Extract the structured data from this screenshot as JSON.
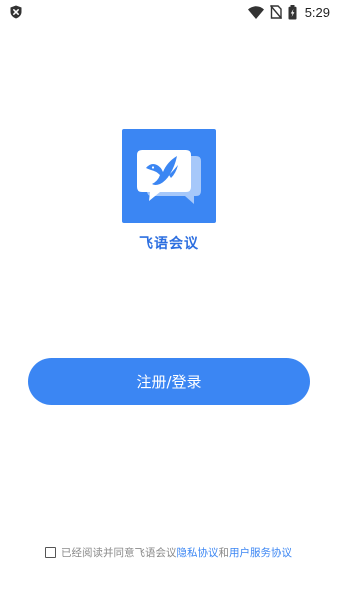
{
  "status_bar": {
    "time": "5:29",
    "icons": [
      "shield-x-icon",
      "wifi-icon",
      "no-sim-icon",
      "battery-icon"
    ]
  },
  "app": {
    "name": "飞语会议",
    "logo_icon": "bird-chat-bubble-icon",
    "brand_color": "#3b86f3"
  },
  "actions": {
    "register_login_label": "注册/登录"
  },
  "agreement": {
    "prefix": "已经阅读并同意飞语会议",
    "privacy_link": "隐私协议",
    "conjunction": "和",
    "terms_link": "用户服务协议",
    "checked": false
  }
}
